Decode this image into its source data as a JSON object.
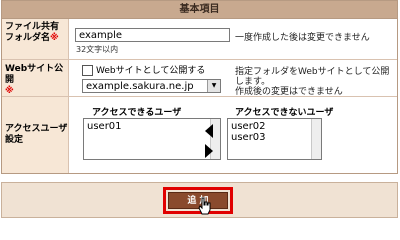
{
  "header": {
    "title": "基本項目"
  },
  "rows": {
    "folder": {
      "label_line1": "ファイル共有",
      "label_line2": "フォルダ名",
      "required_mark": "※",
      "input_value": "example",
      "note": "32文字以内",
      "remark": "一度作成した後は変更できません"
    },
    "web": {
      "label_line1": "Webサイト公開",
      "required_mark": "※",
      "checkbox_label": "Webサイトとして公開する",
      "checkbox_checked": false,
      "select_value": "example.sakura.ne.jp",
      "remark_line1": "指定フォルダをWebサイトとして公開します。",
      "remark_line2": "作成後の変更はできません"
    },
    "access": {
      "label_line1": "アクセスユーザ",
      "label_line2": "設定",
      "allowed_header": "アクセスできるユーザ",
      "allowed_users": [
        "user01"
      ],
      "denied_header": "アクセスできないユーザ",
      "denied_users": [
        "user02",
        "user03"
      ]
    }
  },
  "footer": {
    "add_button": "追 加"
  },
  "colors": {
    "header_bg": "#c8a98f",
    "label_bg": "#f7e7d6",
    "button_bg": "#8a4a2d",
    "highlight": "#e00000",
    "required": "#e00000"
  }
}
